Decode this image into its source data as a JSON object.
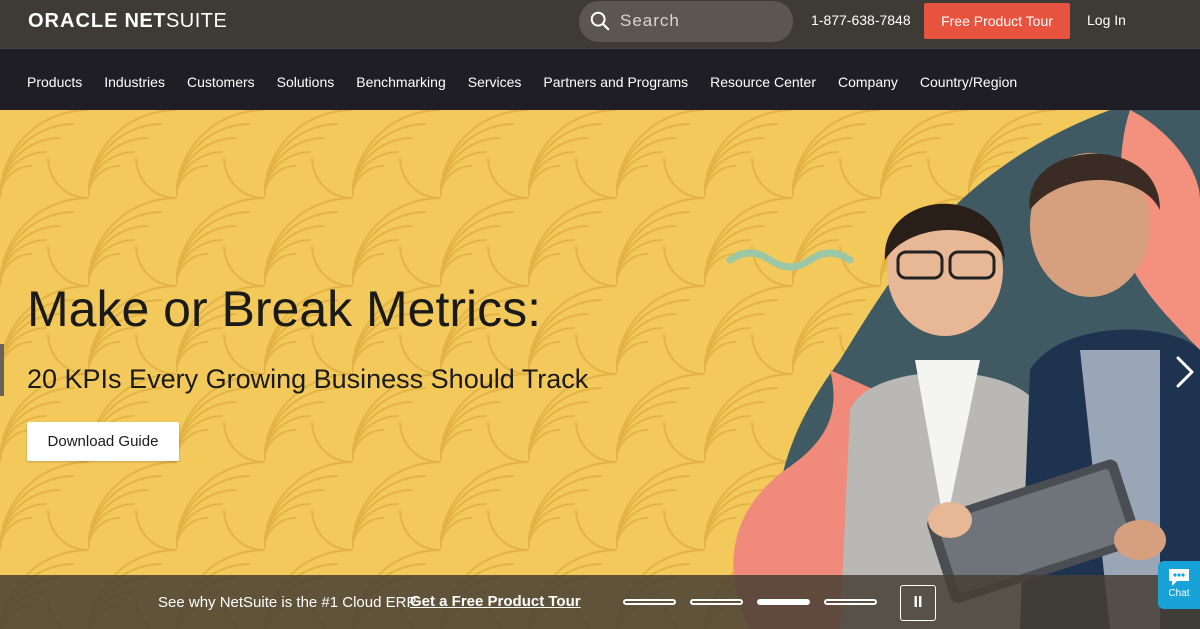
{
  "header": {
    "logo_oracle": "ORACLE",
    "logo_net": "NET",
    "logo_suite": "SUITE",
    "search_placeholder": "Search",
    "phone": "1-877-638-7848",
    "tour_button": "Free Product Tour",
    "login": "Log In"
  },
  "nav": {
    "items": [
      "Products",
      "Industries",
      "Customers",
      "Solutions",
      "Benchmarking",
      "Services",
      "Partners and Programs",
      "Resource Center",
      "Company",
      "Country/Region"
    ]
  },
  "hero": {
    "title": "Make or Break Metrics:",
    "subtitle": "20 KPIs Every Growing Business Should Track",
    "button": "Download Guide"
  },
  "banner": {
    "text": "See why NetSuite is the #1 Cloud ERP",
    "link": "Get a Free Product Tour",
    "slides": 4,
    "active_slide": 3,
    "pause_symbol": "II"
  },
  "chat": {
    "label": "Chat"
  },
  "colors": {
    "topbar": "#3e3a36",
    "navbar": "#1f1e24",
    "accent": "#e8533f",
    "hero_bg": "#f2c95a",
    "chat": "#17a2d8"
  }
}
